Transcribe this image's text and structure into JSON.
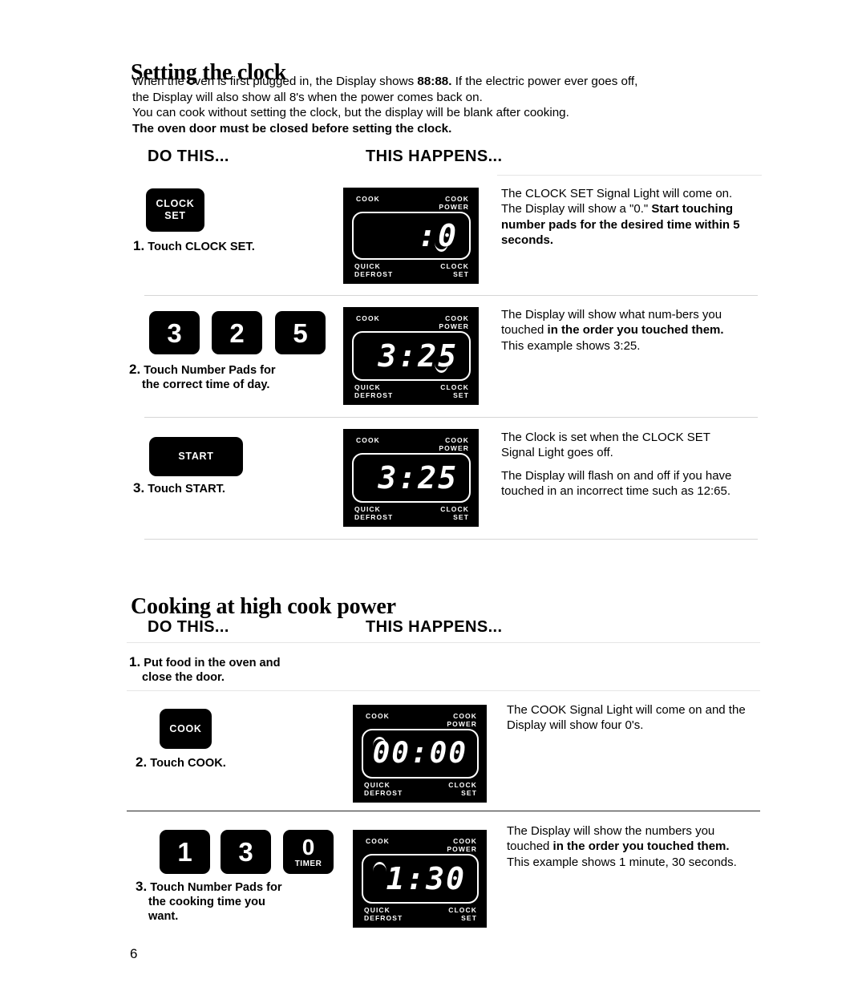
{
  "page": {
    "number": "6"
  },
  "section1": {
    "title": "Setting the clock",
    "intro_para1_a": "When the oven is first plugged in, the Display shows ",
    "intro_para1_bold": "88:88.",
    "intro_para1_b": " If the electric power ever goes off, the Display will also show all 8's when the power comes back on.",
    "intro_para2": "You can cook without setting the clock, but the display will be blank after cooking.",
    "intro_para2_bold": "The oven door must be closed before setting the clock.",
    "col_do": "DO THIS...",
    "col_happens": "THIS HAPPENS...",
    "steps": [
      {
        "number": "1.",
        "label": "Touch CLOCK SET.",
        "button": {
          "line1": "CLOCK",
          "line2": "SET"
        },
        "display": {
          "readout": ":0",
          "label_top_left": "COOK",
          "label_top_right": "COOK\nPOWER",
          "label_bottom_left": "QUICK\nDEFROST",
          "label_bottom_right": "CLOCK\nSET"
        },
        "desc_a": "The CLOCK SET Signal Light will come on. The Display will show a \"0.\" ",
        "desc_bold": "Start touching number pads for the desired time within 5 seconds.",
        "desc_b": ""
      },
      {
        "number": "2.",
        "label_line1": "Touch Number Pads for",
        "label_line2": "the correct time of day.",
        "keys": [
          "3",
          "2",
          "5"
        ],
        "display": {
          "readout": "3:25",
          "label_top_left": "COOK",
          "label_top_right": "COOK\nPOWER",
          "label_bottom_left": "QUICK\nDEFROST",
          "label_bottom_right": "CLOCK\nSET"
        },
        "desc_a": "The Display will show what num-bers you touched ",
        "desc_bold": "in the order you touched them.",
        "desc_b": " This example shows 3:25."
      },
      {
        "number": "3.",
        "label": "Touch START.",
        "button": {
          "line1": "START"
        },
        "display": {
          "readout": "3:25",
          "label_top_left": "COOK",
          "label_top_right": "COOK\nPOWER",
          "label_bottom_left": "QUICK\nDEFROST",
          "label_bottom_right": "CLOCK\nSET"
        },
        "desc_p1": "The Clock is set when the CLOCK SET Signal Light goes off.",
        "desc_p2": "The Display will flash on and off if you have touched in an incorrect time such as 12:65."
      }
    ]
  },
  "section2": {
    "title": "Cooking at high cook power",
    "col_do": "DO THIS...",
    "col_happens": "THIS HAPPENS...",
    "steps": [
      {
        "number": "1.",
        "label_line1": "Put food in the oven and",
        "label_line2": "close the door."
      },
      {
        "number": "2.",
        "label": "Touch COOK.",
        "button": {
          "line1": "COOK"
        },
        "display": {
          "readout": "00:00",
          "label_top_left": "COOK",
          "label_top_right": "COOK\nPOWER",
          "label_bottom_left": "QUICK\nDEFROST",
          "label_bottom_right": "CLOCK\nSET"
        },
        "desc": "The COOK Signal Light will come on and the Display will show four 0's."
      },
      {
        "number": "3.",
        "label_line1": "Touch Number Pads for",
        "label_line2": "the cooking time you",
        "label_line3": "want.",
        "keys": [
          "1",
          "3",
          "0"
        ],
        "key_sublabel": "TIMER",
        "display": {
          "readout": "1:30",
          "label_top_left": "COOK",
          "label_top_right": "COOK\nPOWER",
          "label_bottom_left": "QUICK\nDEFROST",
          "label_bottom_right": "CLOCK\nSET"
        },
        "desc_a": "The Display will show the numbers you touched ",
        "desc_bold": "in the order you touched them.",
        "desc_b": " This example shows 1 minute, 30 seconds."
      }
    ]
  }
}
